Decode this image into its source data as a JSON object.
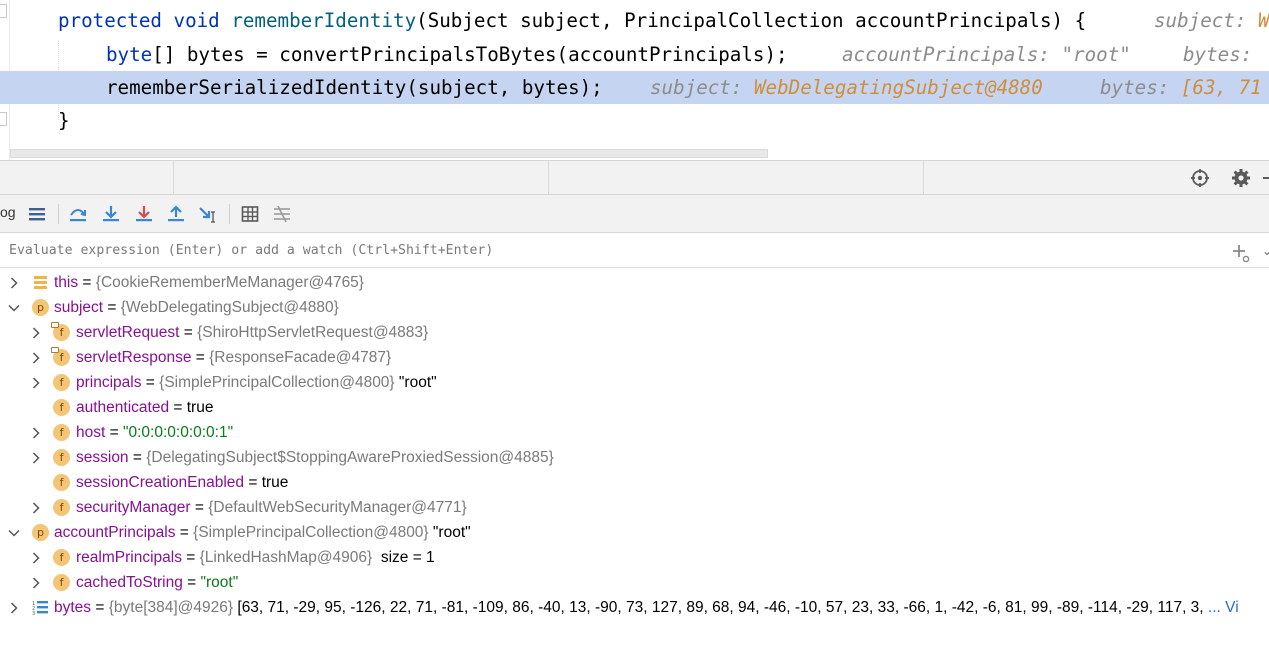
{
  "editor": {
    "lines": [
      {
        "kw1": "protected",
        "kw2": "void",
        "fn": "rememberIdentity",
        "rest": "(Subject subject, PrincipalCollection accountPrincipals) {",
        "hint_label": "subject:",
        "hint_value": "W"
      },
      {
        "kw1": "byte",
        "rest": "[] bytes = convertPrincipalsToBytes(accountPrincipals);",
        "hint1": "accountPrincipals: \"root\"",
        "hint2": "bytes: "
      },
      {
        "code": "rememberSerializedIdentity(subject, bytes);",
        "hint_label1": "subject:",
        "hint_value1": "WebDelegatingSubject@4880",
        "hint_label2": "bytes:",
        "hint_value2": "[63, 71"
      },
      {
        "code": "}"
      }
    ]
  },
  "toolbar": {
    "truncated_label": "og"
  },
  "evaluate": {
    "placeholder": "Evaluate expression (Enter) or add a watch (Ctrl+Shift+Enter)"
  },
  "variables": {
    "this": {
      "name": "this",
      "eq": " = ",
      "type": "{CookieRememberMeManager@4765}"
    },
    "subject": {
      "name": "subject",
      "eq": " = ",
      "type": "{WebDelegatingSubject@4880}",
      "fields": {
        "servletRequest": {
          "name": "servletRequest",
          "eq": " = ",
          "type": "{ShiroHttpServletRequest@4883}"
        },
        "servletResponse": {
          "name": "servletResponse",
          "eq": " = ",
          "type": "{ResponseFacade@4787}"
        },
        "principals": {
          "name": "principals",
          "eq": " = ",
          "type": "{SimplePrincipalCollection@4800}",
          "value": " \"root\""
        },
        "authenticated": {
          "name": "authenticated",
          "eq": " = ",
          "value": "true"
        },
        "host": {
          "name": "host",
          "eq": " = ",
          "value": "\"0:0:0:0:0:0:0:1\""
        },
        "session": {
          "name": "session",
          "eq": " = ",
          "type": "{DelegatingSubject$StoppingAwareProxiedSession@4885}"
        },
        "sessionCreationEnabled": {
          "name": "sessionCreationEnabled",
          "eq": " = ",
          "value": "true"
        },
        "securityManager": {
          "name": "securityManager",
          "eq": " = ",
          "type": "{DefaultWebSecurityManager@4771}"
        }
      }
    },
    "accountPrincipals": {
      "name": "accountPrincipals",
      "eq": " = ",
      "type": "{SimplePrincipalCollection@4800}",
      "value": " \"root\"",
      "fields": {
        "realmPrincipals": {
          "name": "realmPrincipals",
          "eq": " = ",
          "type": "{LinkedHashMap@4906}",
          "value": "  size = 1"
        },
        "cachedToString": {
          "name": "cachedToString",
          "eq": " = ",
          "value": "\"root\""
        }
      }
    },
    "bytes": {
      "name": "bytes",
      "eq": " = ",
      "type": "{byte[384]@4926}",
      "value": " [63, 71, -29, 95, -126, 22, 71, -81, -109, 86, -40, 13, -90, 73, 127, 89, 68, 94, -46, -10, 57, 23, 33, -66, 1, -42, -6, 81, 99, -89, -114, -29, 117, 3, ",
      "link": "... Vi"
    }
  },
  "colors": {
    "exec_line": "#c5d5f1",
    "keyword": "#0033b3",
    "hint_value": "#cf8e3c",
    "var_name": "#871094",
    "string": "#067d17"
  }
}
